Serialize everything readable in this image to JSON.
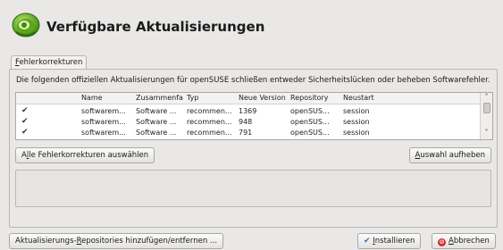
{
  "header": {
    "title": "Verfügbare Aktualisierungen"
  },
  "tabs": [
    {
      "label": "Fehlerkorrekturen",
      "mnemonic": "F",
      "rest": "ehlerkorrekturen"
    }
  ],
  "panel": {
    "description": "Die folgenden offiziellen Aktualisierungen für openSUSE schließen entweder Sicherheitslücken oder beheben Softwarefehler.",
    "columns": [
      "Name",
      "Zusammenfa",
      "Typ",
      "Neue Version",
      "Repository",
      "Neustart"
    ],
    "rows": [
      {
        "checked": true,
        "name": "softwarem...",
        "summary": "Software ...",
        "type": "recommen...",
        "version": "1369",
        "repository": "openSUS...",
        "restart": "session"
      },
      {
        "checked": true,
        "name": "softwarem...",
        "summary": "Software ...",
        "type": "recommen...",
        "version": "948",
        "repository": "openSUS...",
        "restart": "session"
      },
      {
        "checked": true,
        "name": "softwarem...",
        "summary": "Software ...",
        "type": "recommen...",
        "version": "791",
        "repository": "openSUS...",
        "restart": "session"
      }
    ],
    "select_all": {
      "pre": "A",
      "mnemonic": "l",
      "post": "le Fehlerkorrekturen auswählen"
    },
    "clear_selection": {
      "mnemonic": "A",
      "post": "uswahl aufheben"
    }
  },
  "footer": {
    "repos_button": {
      "pre": "Aktualisierungs-",
      "mnemonic": "R",
      "post": "epositories hinzufügen/entfernen ..."
    },
    "install_button": {
      "mnemonic": "I",
      "post": "nstallieren"
    },
    "cancel_button": {
      "mnemonic": "A",
      "post": "bbrechen"
    }
  },
  "colors": {
    "accent": "#3a6fb0",
    "cancel": "#d22d2d",
    "logo": "#73ba25"
  },
  "icons": {
    "logo": "opensuse-logo-icon",
    "check": "checkmark-icon",
    "cancel": "cancel-icon",
    "scroll_up": "chevron-up-icon",
    "scroll_down": "chevron-down-icon"
  }
}
